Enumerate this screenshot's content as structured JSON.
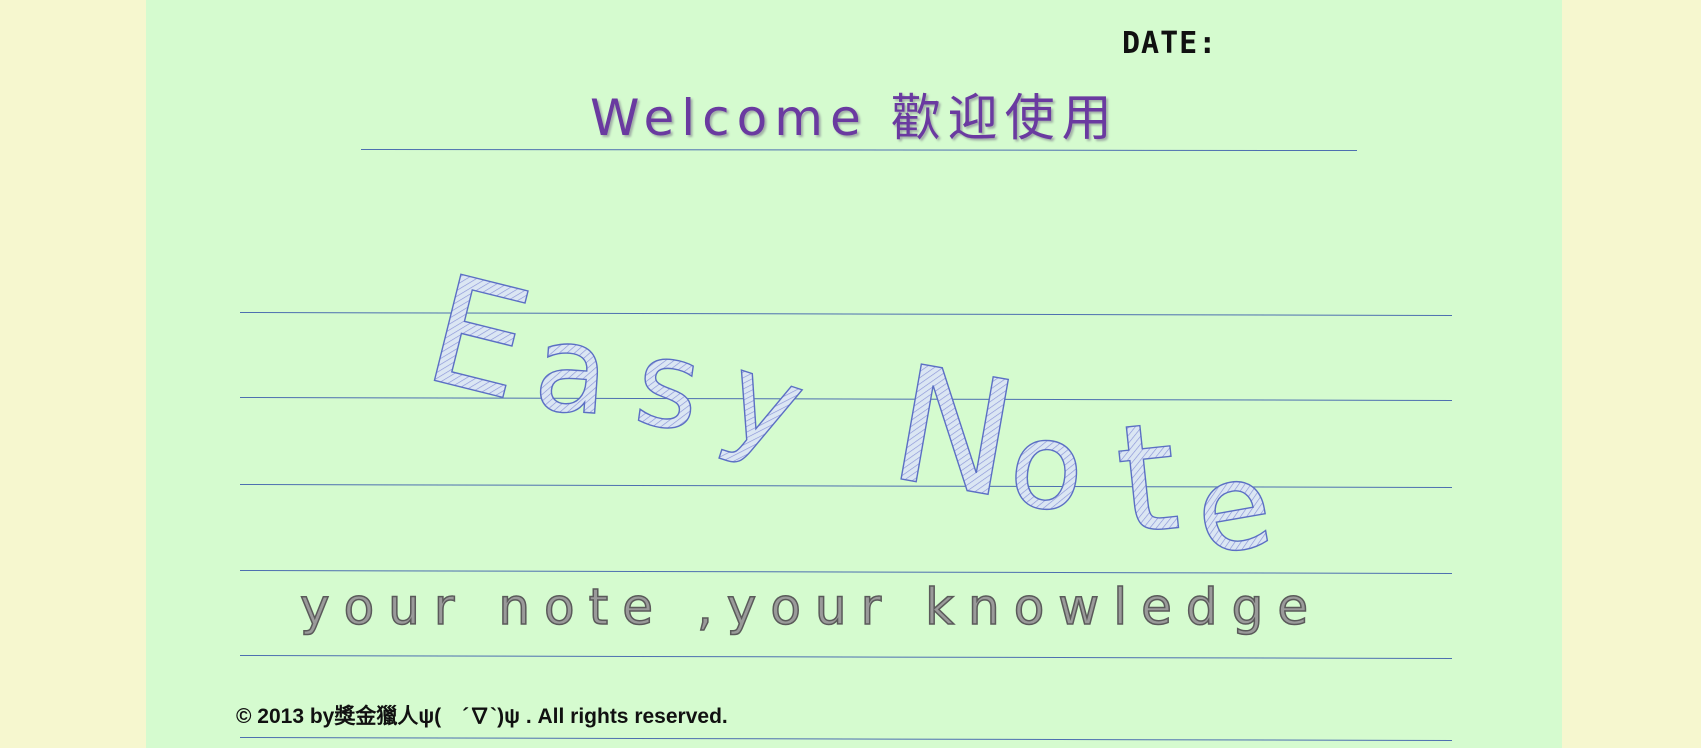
{
  "header": {
    "date_label": "DATE:",
    "welcome_text": "Welcome 歡迎使用"
  },
  "logo": {
    "word_1": "Easy",
    "word_2": "Note",
    "stroke_color": "#5b6fc4",
    "hatch_color": "#8a94d8"
  },
  "slogan": {
    "text": "your note ,your knowledge"
  },
  "footer": {
    "copyright": "© 2013 by獎金獵人ψ(　´∇`)ψ . All rights reserved."
  },
  "colors": {
    "page_background": "#f6f7cf",
    "paper_background": "#d5fbcf",
    "rule_line": "#4d6fb0",
    "welcome_text": "#6a3aa0"
  }
}
